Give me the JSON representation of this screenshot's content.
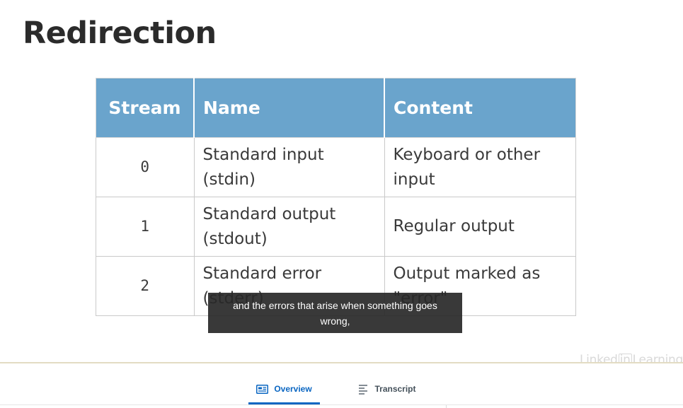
{
  "slide": {
    "title": "Redirection",
    "table": {
      "headers": [
        "Stream",
        "Name",
        "Content"
      ],
      "rows": [
        {
          "stream": "0",
          "name": "Standard input (stdin)",
          "content": "Keyboard or other input"
        },
        {
          "stream": "1",
          "name": "Standard output (stdout)",
          "content": "Regular output"
        },
        {
          "stream": "2",
          "name": "Standard error (stderr)",
          "content": "Output marked as \"error\""
        }
      ]
    },
    "header_color": "#6aa4cc"
  },
  "caption": {
    "text": "and the errors that arise when something goes wrong,"
  },
  "watermark": {
    "part1": "Linked",
    "part2": "in",
    "part3": "Learning"
  },
  "tabs": [
    {
      "label": "Overview",
      "icon": "overview-icon",
      "active": true
    },
    {
      "label": "Transcript",
      "icon": "transcript-icon",
      "active": false
    }
  ],
  "accent_color": "#0a66c2"
}
